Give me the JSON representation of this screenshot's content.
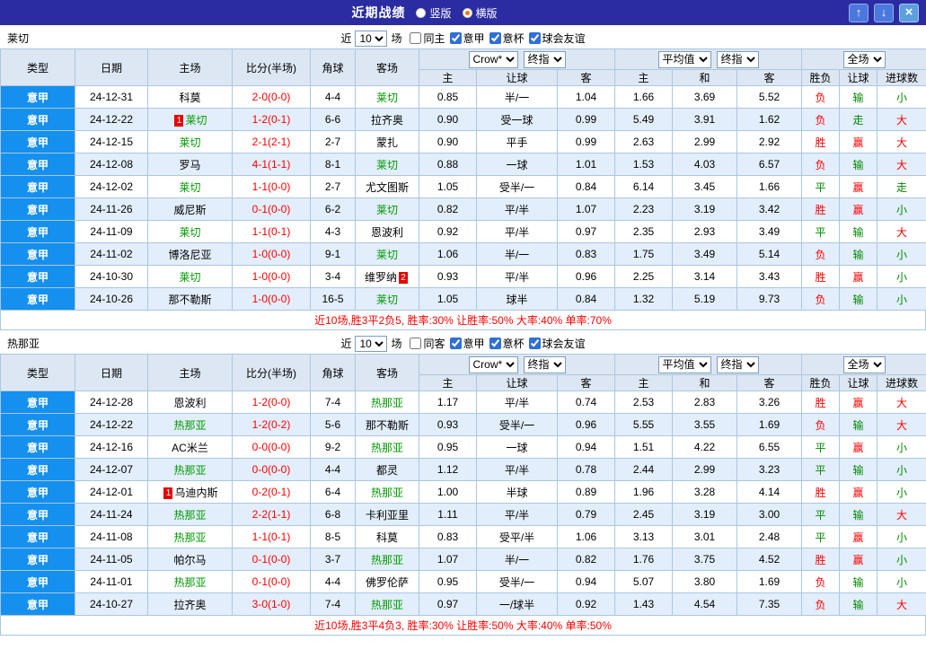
{
  "titlebar": {
    "title": "近期战绩",
    "vertical_label": "竖版",
    "horizontal_label": "横版",
    "up_icon": "↑",
    "down_icon": "↓",
    "close_icon": "×"
  },
  "table": {
    "selects": {
      "bookmaker": "Crow*",
      "bookmaker_final": "终指",
      "average": "平均值",
      "average_final": "终指",
      "fulltime": "全场"
    },
    "columns": [
      "类型",
      "日期",
      "主场",
      "比分(半场)",
      "角球",
      "客场"
    ],
    "odds_columns": [
      "主",
      "让球",
      "客",
      "主",
      "和",
      "客",
      "胜负",
      "让球",
      "进球数"
    ]
  },
  "value_colors": {
    "胜": "#ff0000",
    "负": "#ff0000",
    "平": "#008800",
    "赢": "#ff0000",
    "输": "#008800",
    "走": "#008800",
    "大": "#ff0000",
    "小": "#008800"
  },
  "sections": [
    {
      "team": "莱切",
      "filter": {
        "near_label": "近",
        "count": "10",
        "games_label": "场",
        "checkboxes": [
          {
            "label": "同主",
            "checked": false
          },
          {
            "label": "意甲",
            "checked": true
          },
          {
            "label": "意杯",
            "checked": true
          },
          {
            "label": "球会友谊",
            "checked": true
          }
        ]
      },
      "rows": [
        {
          "league": "意甲",
          "date": "24-12-31",
          "home": "科莫",
          "home_card": "",
          "home_hl": false,
          "score": "2-0(0-0)",
          "corner": "4-4",
          "away": "莱切",
          "away_card": "",
          "away_hl": true,
          "odds": [
            "0.85",
            "半/一",
            "1.04",
            "1.66",
            "3.69",
            "5.52"
          ],
          "result": "负",
          "handicap": "输",
          "goals": "小"
        },
        {
          "league": "意甲",
          "date": "24-12-22",
          "home": "莱切",
          "home_card": "1",
          "home_hl": true,
          "score": "1-2(0-1)",
          "corner": "6-6",
          "away": "拉齐奥",
          "away_card": "",
          "away_hl": false,
          "odds": [
            "0.90",
            "受一球",
            "0.99",
            "5.49",
            "3.91",
            "1.62"
          ],
          "result": "负",
          "handicap": "走",
          "goals": "大"
        },
        {
          "league": "意甲",
          "date": "24-12-15",
          "home": "莱切",
          "home_card": "",
          "home_hl": true,
          "score": "2-1(2-1)",
          "corner": "2-7",
          "away": "蒙扎",
          "away_card": "",
          "away_hl": false,
          "odds": [
            "0.90",
            "平手",
            "0.99",
            "2.63",
            "2.99",
            "2.92"
          ],
          "result": "胜",
          "handicap": "赢",
          "goals": "大"
        },
        {
          "league": "意甲",
          "date": "24-12-08",
          "home": "罗马",
          "home_card": "",
          "home_hl": false,
          "score": "4-1(1-1)",
          "corner": "8-1",
          "away": "莱切",
          "away_card": "",
          "away_hl": true,
          "odds": [
            "0.88",
            "一球",
            "1.01",
            "1.53",
            "4.03",
            "6.57"
          ],
          "result": "负",
          "handicap": "输",
          "goals": "大"
        },
        {
          "league": "意甲",
          "date": "24-12-02",
          "home": "莱切",
          "home_card": "",
          "home_hl": true,
          "score": "1-1(0-0)",
          "corner": "2-7",
          "away": "尤文图斯",
          "away_card": "",
          "away_hl": false,
          "odds": [
            "1.05",
            "受半/一",
            "0.84",
            "6.14",
            "3.45",
            "1.66"
          ],
          "result": "平",
          "handicap": "赢",
          "goals": "走"
        },
        {
          "league": "意甲",
          "date": "24-11-26",
          "home": "威尼斯",
          "home_card": "",
          "home_hl": false,
          "score": "0-1(0-0)",
          "corner": "6-2",
          "away": "莱切",
          "away_card": "",
          "away_hl": true,
          "odds": [
            "0.82",
            "平/半",
            "1.07",
            "2.23",
            "3.19",
            "3.42"
          ],
          "result": "胜",
          "handicap": "赢",
          "goals": "小"
        },
        {
          "league": "意甲",
          "date": "24-11-09",
          "home": "莱切",
          "home_card": "",
          "home_hl": true,
          "score": "1-1(0-1)",
          "corner": "4-3",
          "away": "恩波利",
          "away_card": "",
          "away_hl": false,
          "odds": [
            "0.92",
            "平/半",
            "0.97",
            "2.35",
            "2.93",
            "3.49"
          ],
          "result": "平",
          "handicap": "输",
          "goals": "大"
        },
        {
          "league": "意甲",
          "date": "24-11-02",
          "home": "博洛尼亚",
          "home_card": "",
          "home_hl": false,
          "score": "1-0(0-0)",
          "corner": "9-1",
          "away": "莱切",
          "away_card": "",
          "away_hl": true,
          "odds": [
            "1.06",
            "半/一",
            "0.83",
            "1.75",
            "3.49",
            "5.14"
          ],
          "result": "负",
          "handicap": "输",
          "goals": "小"
        },
        {
          "league": "意甲",
          "date": "24-10-30",
          "home": "莱切",
          "home_card": "",
          "home_hl": true,
          "score": "1-0(0-0)",
          "corner": "3-4",
          "away": "维罗纳",
          "away_card": "2",
          "away_hl": false,
          "odds": [
            "0.93",
            "平/半",
            "0.96",
            "2.25",
            "3.14",
            "3.43"
          ],
          "result": "胜",
          "handicap": "赢",
          "goals": "小"
        },
        {
          "league": "意甲",
          "date": "24-10-26",
          "home": "那不勒斯",
          "home_card": "",
          "home_hl": false,
          "score": "1-0(0-0)",
          "corner": "16-5",
          "away": "莱切",
          "away_card": "",
          "away_hl": true,
          "odds": [
            "1.05",
            "球半",
            "0.84",
            "1.32",
            "5.19",
            "9.73"
          ],
          "result": "负",
          "handicap": "输",
          "goals": "小"
        }
      ],
      "summary": "近10场,胜3平2负5, 胜率:30% 让胜率:50% 大率:40% 单率:70%"
    },
    {
      "team": "热那亚",
      "filter": {
        "near_label": "近",
        "count": "10",
        "games_label": "场",
        "checkboxes": [
          {
            "label": "同客",
            "checked": false
          },
          {
            "label": "意甲",
            "checked": true
          },
          {
            "label": "意杯",
            "checked": true
          },
          {
            "label": "球会友谊",
            "checked": true
          }
        ]
      },
      "rows": [
        {
          "league": "意甲",
          "date": "24-12-28",
          "home": "恩波利",
          "home_card": "",
          "home_hl": false,
          "score": "1-2(0-0)",
          "corner": "7-4",
          "away": "热那亚",
          "away_card": "",
          "away_hl": true,
          "odds": [
            "1.17",
            "平/半",
            "0.74",
            "2.53",
            "2.83",
            "3.26"
          ],
          "result": "胜",
          "handicap": "赢",
          "goals": "大"
        },
        {
          "league": "意甲",
          "date": "24-12-22",
          "home": "热那亚",
          "home_card": "",
          "home_hl": true,
          "score": "1-2(0-2)",
          "corner": "5-6",
          "away": "那不勒斯",
          "away_card": "",
          "away_hl": false,
          "odds": [
            "0.93",
            "受半/一",
            "0.96",
            "5.55",
            "3.55",
            "1.69"
          ],
          "result": "负",
          "handicap": "输",
          "goals": "大"
        },
        {
          "league": "意甲",
          "date": "24-12-16",
          "home": "AC米兰",
          "home_card": "",
          "home_hl": false,
          "score": "0-0(0-0)",
          "corner": "9-2",
          "away": "热那亚",
          "away_card": "",
          "away_hl": true,
          "odds": [
            "0.95",
            "一球",
            "0.94",
            "1.51",
            "4.22",
            "6.55"
          ],
          "result": "平",
          "handicap": "赢",
          "goals": "小"
        },
        {
          "league": "意甲",
          "date": "24-12-07",
          "home": "热那亚",
          "home_card": "",
          "home_hl": true,
          "score": "0-0(0-0)",
          "corner": "4-4",
          "away": "都灵",
          "away_card": "",
          "away_hl": false,
          "odds": [
            "1.12",
            "平/半",
            "0.78",
            "2.44",
            "2.99",
            "3.23"
          ],
          "result": "平",
          "handicap": "输",
          "goals": "小"
        },
        {
          "league": "意甲",
          "date": "24-12-01",
          "home": "乌迪内斯",
          "home_card": "1",
          "home_hl": false,
          "score": "0-2(0-1)",
          "corner": "6-4",
          "away": "热那亚",
          "away_card": "",
          "away_hl": true,
          "odds": [
            "1.00",
            "半球",
            "0.89",
            "1.96",
            "3.28",
            "4.14"
          ],
          "result": "胜",
          "handicap": "赢",
          "goals": "小"
        },
        {
          "league": "意甲",
          "date": "24-11-24",
          "home": "热那亚",
          "home_card": "",
          "home_hl": true,
          "score": "2-2(1-1)",
          "corner": "6-8",
          "away": "卡利亚里",
          "away_card": "",
          "away_hl": false,
          "odds": [
            "1.11",
            "平/半",
            "0.79",
            "2.45",
            "3.19",
            "3.00"
          ],
          "result": "平",
          "handicap": "输",
          "goals": "大"
        },
        {
          "league": "意甲",
          "date": "24-11-08",
          "home": "热那亚",
          "home_card": "",
          "home_hl": true,
          "score": "1-1(0-1)",
          "corner": "8-5",
          "away": "科莫",
          "away_card": "",
          "away_hl": false,
          "odds": [
            "0.83",
            "受平/半",
            "1.06",
            "3.13",
            "3.01",
            "2.48"
          ],
          "result": "平",
          "handicap": "赢",
          "goals": "小"
        },
        {
          "league": "意甲",
          "date": "24-11-05",
          "home": "帕尔马",
          "home_card": "",
          "home_hl": false,
          "score": "0-1(0-0)",
          "corner": "3-7",
          "away": "热那亚",
          "away_card": "",
          "away_hl": true,
          "odds": [
            "1.07",
            "半/一",
            "0.82",
            "1.76",
            "3.75",
            "4.52"
          ],
          "result": "胜",
          "handicap": "赢",
          "goals": "小"
        },
        {
          "league": "意甲",
          "date": "24-11-01",
          "home": "热那亚",
          "home_card": "",
          "home_hl": true,
          "score": "0-1(0-0)",
          "corner": "4-4",
          "away": "佛罗伦萨",
          "away_card": "",
          "away_hl": false,
          "odds": [
            "0.95",
            "受半/一",
            "0.94",
            "5.07",
            "3.80",
            "1.69"
          ],
          "result": "负",
          "handicap": "输",
          "goals": "小"
        },
        {
          "league": "意甲",
          "date": "24-10-27",
          "home": "拉齐奥",
          "home_card": "",
          "home_hl": false,
          "score": "3-0(1-0)",
          "corner": "7-4",
          "away": "热那亚",
          "away_card": "",
          "away_hl": true,
          "odds": [
            "0.97",
            "一/球半",
            "0.92",
            "1.43",
            "4.54",
            "7.35"
          ],
          "result": "负",
          "handicap": "输",
          "goals": "大"
        }
      ],
      "summary": "近10场,胜3平4负3, 胜率:30% 让胜率:50% 大率:40% 单率:50%"
    }
  ]
}
